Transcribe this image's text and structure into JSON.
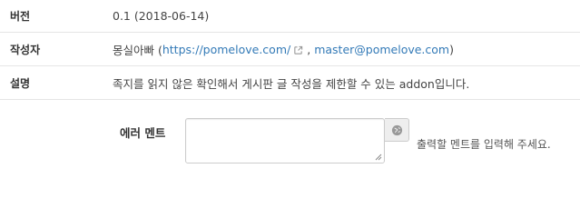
{
  "info": {
    "version_label": "버전",
    "version_value": "0.1 (2018-06-14)",
    "author_label": "작성자",
    "author_name": "몽실아빠 (",
    "author_url": "https://pomelove.com/",
    "author_sep": ",",
    "author_email": "master@pomelove.com",
    "author_close": ")",
    "desc_label": "설명",
    "desc_value": "족지를 읽지 않은 확인해서 게시판 글 작성을 제한할 수 있는 addon입니다."
  },
  "form": {
    "error_label": "에러 멘트",
    "error_value": "",
    "help_text": "출력할 멘트를 입력해 주세요."
  },
  "icons": {
    "external_link": "external-link-icon",
    "globe": "globe-icon",
    "resize": "resize-grip-icon"
  },
  "colors": {
    "link": "#337ab7",
    "border": "#e5e5e5"
  }
}
